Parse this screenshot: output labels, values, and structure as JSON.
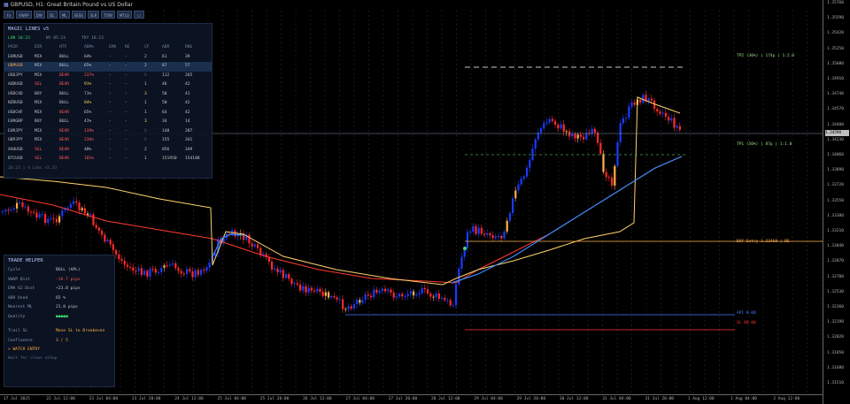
{
  "window": {
    "title": "GBPUSD, H1: Great Britain Pound vs US Dollar"
  },
  "toolbar": {
    "buttons": [
      "Fx",
      "VWAP",
      "DW",
      "DL",
      "ML",
      "SESS",
      "SLR",
      "TOW",
      "MTLO",
      "☐"
    ]
  },
  "magic": {
    "title": "MAGIC LINES v5",
    "session_lon": "LON 10:23",
    "session_ny": "NY 05:23",
    "session_tky": "TKY 18:23",
    "columns": [
      "PAIR",
      "DIR",
      "HTF",
      "ADR%",
      "EMA",
      "RE",
      "CF",
      "ADR",
      "RNG"
    ],
    "rows": [
      [
        "EURUSD",
        "MIX",
        "BULL",
        "64%",
        "-",
        "-",
        "2",
        "61",
        "39"
      ],
      [
        "GBPUSD",
        "MIX",
        "BULL",
        "65%",
        "-",
        "-",
        "2",
        "87",
        "57"
      ],
      [
        "USDJPY",
        "MIX",
        "BEAR",
        "237%",
        "-",
        "-",
        "0",
        "112",
        "265"
      ],
      [
        "AUDUSD",
        "SEL",
        "BEAR",
        "91%",
        "-",
        "-",
        "1",
        "46",
        "42"
      ],
      [
        "USDCAD",
        "BUY",
        "BULL",
        "71%",
        "-",
        "-",
        "3",
        "58",
        "41"
      ],
      [
        "NZDUSD",
        "MIX",
        "BULL",
        "84%",
        "-",
        "-",
        "1",
        "50",
        "42"
      ],
      [
        "USDCHF",
        "MIX",
        "BEAR",
        "65%",
        "-",
        "-",
        "1",
        "64",
        "42"
      ],
      [
        "EURGBP",
        "BUY",
        "BULL",
        "41%",
        "-",
        "-",
        "3",
        "34",
        "14"
      ],
      [
        "EURJPY",
        "MIX",
        "BEAR",
        "139%",
        "-",
        "-",
        "0",
        "148",
        "207"
      ],
      [
        "GBPJPY",
        "MIX",
        "BEAR",
        "230%",
        "-",
        "-",
        "0",
        "155",
        "341"
      ],
      [
        "XAUUSD",
        "SEL",
        "BEAR",
        "40%",
        "-",
        "-",
        "2",
        "856",
        "349"
      ],
      [
        "BTCUSD",
        "SEL",
        "BEAR",
        "101%",
        "-",
        "-",
        "1",
        "151950",
        "154188"
      ]
    ],
    "footer": "10:23 | 4 Labs v5.33"
  },
  "trade_helper": {
    "title": "TRADE HELPER",
    "rows": [
      {
        "label": "Cycle",
        "value": "BULL (APL)"
      },
      {
        "label": "VWAP Dist",
        "value": "-19.7 pips"
      },
      {
        "label": "EMA 62 Dist",
        "value": "+23.0 pips"
      },
      {
        "label": "ADR Used",
        "value": "65 %"
      },
      {
        "label": "Nearest ML",
        "value": "21.0 pips"
      },
      {
        "label": "Quality",
        "value": "●●●●●"
      }
    ],
    "trail_label": "Trail SL",
    "trail_value": "Move SL to Breakeven",
    "confluence_label": "Confluence",
    "confluence_value": "3 / 5",
    "watch": "> WATCH ENTRY",
    "wait": "Wait for clean setup"
  },
  "levels": {
    "tp2": "TP2 (30%) | 174p | 1:2.0",
    "tp1": "TP1 (50%) | 87p | 1:1.0",
    "buy_entry": "BUY Entry 1.33460 | BE",
    "api": "API 0.00",
    "sl": "SL 00.00"
  },
  "price_current": "1.34590",
  "y_axis": [
    "1.35760",
    "1.35590",
    "1.35420",
    "1.35250",
    "1.35080",
    "1.34910",
    "1.34740",
    "1.34570",
    "1.34400",
    "1.34230",
    "1.34060",
    "1.33890",
    "1.33720",
    "1.33550",
    "1.33380",
    "1.33210",
    "1.33040",
    "1.32870",
    "1.32700",
    "1.32530",
    "1.32360",
    "1.32190",
    "1.32020",
    "1.31850",
    "1.31680",
    "1.31510"
  ],
  "x_axis": [
    "17 Jul 2025",
    "22 Jul 12:00",
    "23 Jul 04:00",
    "23 Jul 20:00",
    "24 Jul 12:00",
    "25 Jul 04:00",
    "25 Jul 20:00",
    "26 Jul 12:00",
    "27 Jul 04:00",
    "27 Jul 20:00",
    "28 Jul 12:00",
    "29 Jul 04:00",
    "29 Jul 20:00",
    "30 Jul 12:00",
    "31 Jul 04:00",
    "31 Jul 20:00",
    "1 Aug 12:00",
    "1 Aug 04:00",
    "2 Aug 12:00"
  ],
  "colors": {
    "bull": "#1a3cff",
    "bear": "#ff2a2a",
    "ema": "#ff3b30",
    "vwap": "#ffd36a",
    "ma_blue": "#3a8cff",
    "tp": "#9be38a",
    "buy": "#ffb04a",
    "sl": "#ff3333",
    "api": "#4a7cff",
    "current": "#c0c0c0"
  }
}
